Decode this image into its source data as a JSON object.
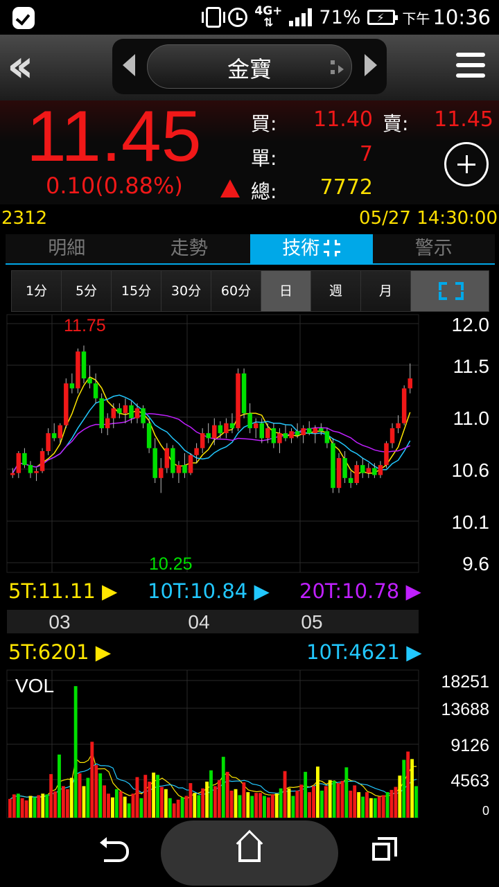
{
  "status_bar": {
    "network": "4G+",
    "battery": "71%",
    "time_prefix": "下午",
    "time": "10:36"
  },
  "header": {
    "stock_name": "金寶"
  },
  "quote": {
    "last_price": "11.45",
    "change": "0.10(0.88%)",
    "bid_label": "買:",
    "bid": "11.40",
    "ask_label": "賣:",
    "ask": "11.45",
    "lot_label": "單:",
    "lot": "7",
    "total_label": "總:",
    "total": "7772",
    "code": "2312",
    "datetime": "05/27 14:30:00",
    "up_color": "#f01818",
    "down_color": "#00e000"
  },
  "tabs": [
    {
      "label": "明細",
      "active": false
    },
    {
      "label": "走勢",
      "active": false
    },
    {
      "label": "技術",
      "active": true
    },
    {
      "label": "警示",
      "active": false
    }
  ],
  "periods": [
    {
      "label": "1分",
      "active": false
    },
    {
      "label": "5分",
      "active": false
    },
    {
      "label": "15分",
      "active": false
    },
    {
      "label": "30分",
      "active": false
    },
    {
      "label": "60分",
      "active": false
    },
    {
      "label": "日",
      "active": true
    },
    {
      "label": "週",
      "active": false
    },
    {
      "label": "月",
      "active": false
    }
  ],
  "ma_legend": {
    "ma5": "5T:11.11",
    "ma10": "10T:10.84",
    "ma20": "20T:10.78",
    "vol5": "5T:6201",
    "vol10": "10T:4621",
    "ma5_color": "#ffe600",
    "ma10_color": "#22c8ff",
    "ma20_color": "#c020ff"
  },
  "chart_data": [
    {
      "type": "candlestick",
      "y_ticks": [
        "12.0",
        "11.5",
        "11.0",
        "10.6",
        "10.1",
        "9.6"
      ],
      "x_ticks": [
        "03",
        "04",
        "05"
      ],
      "high_label": "11.75",
      "low_label": "10.25",
      "ylim": [
        9.6,
        12.0
      ],
      "candles": [
        [
          10.48,
          10.55,
          10.45,
          10.5
        ],
        [
          10.5,
          10.72,
          10.45,
          10.7
        ],
        [
          10.7,
          10.75,
          10.55,
          10.58
        ],
        [
          10.58,
          10.62,
          10.45,
          10.5
        ],
        [
          10.5,
          10.55,
          10.42,
          10.52
        ],
        [
          10.52,
          10.75,
          10.5,
          10.72
        ],
        [
          10.72,
          10.95,
          10.68,
          10.9
        ],
        [
          10.9,
          11.0,
          10.82,
          10.85
        ],
        [
          10.85,
          11.0,
          10.8,
          10.98
        ],
        [
          10.98,
          11.45,
          10.95,
          11.4
        ],
        [
          11.4,
          11.5,
          11.3,
          11.35
        ],
        [
          11.35,
          11.75,
          11.3,
          11.72
        ],
        [
          11.72,
          11.78,
          11.4,
          11.45
        ],
        [
          11.45,
          11.58,
          11.35,
          11.4
        ],
        [
          11.4,
          11.5,
          11.2,
          11.25
        ],
        [
          11.25,
          11.3,
          10.9,
          10.95
        ],
        [
          10.95,
          11.1,
          10.88,
          11.05
        ],
        [
          11.05,
          11.2,
          10.95,
          11.15
        ],
        [
          11.15,
          11.2,
          11.05,
          11.1
        ],
        [
          11.1,
          11.25,
          11.0,
          11.18
        ],
        [
          11.18,
          11.22,
          11.0,
          11.05
        ],
        [
          11.05,
          11.2,
          11.0,
          11.15
        ],
        [
          11.15,
          11.18,
          10.95,
          11.0
        ],
        [
          11.0,
          11.05,
          10.7,
          10.75
        ],
        [
          10.75,
          10.85,
          10.4,
          10.45
        ],
        [
          10.45,
          10.65,
          10.3,
          10.55
        ],
        [
          10.55,
          10.8,
          10.5,
          10.75
        ],
        [
          10.75,
          10.78,
          10.45,
          10.5
        ],
        [
          10.5,
          10.62,
          10.4,
          10.58
        ],
        [
          10.58,
          10.7,
          10.45,
          10.5
        ],
        [
          10.5,
          10.7,
          10.48,
          10.68
        ],
        [
          10.68,
          10.8,
          10.6,
          10.75
        ],
        [
          10.75,
          10.95,
          10.7,
          10.9
        ],
        [
          10.9,
          11.0,
          10.8,
          10.85
        ],
        [
          10.85,
          11.05,
          10.78,
          10.98
        ],
        [
          10.98,
          11.02,
          10.85,
          10.9
        ],
        [
          10.9,
          11.05,
          10.85,
          11.0
        ],
        [
          11.0,
          11.1,
          10.9,
          10.95
        ],
        [
          10.95,
          11.55,
          10.92,
          11.5
        ],
        [
          11.5,
          11.55,
          11.05,
          11.1
        ],
        [
          11.1,
          11.2,
          10.9,
          10.95
        ],
        [
          10.95,
          11.05,
          10.85,
          11.0
        ],
        [
          11.0,
          11.05,
          10.8,
          10.85
        ],
        [
          10.85,
          11.0,
          10.8,
          10.95
        ],
        [
          10.95,
          11.0,
          10.75,
          10.8
        ],
        [
          10.8,
          10.95,
          10.7,
          10.9
        ],
        [
          10.9,
          10.98,
          10.82,
          10.85
        ],
        [
          10.85,
          10.95,
          10.8,
          10.92
        ],
        [
          10.92,
          11.0,
          10.85,
          10.88
        ],
        [
          10.88,
          10.98,
          10.8,
          10.95
        ],
        [
          10.95,
          11.02,
          10.88,
          10.9
        ],
        [
          10.9,
          10.98,
          10.8,
          10.95
        ],
        [
          10.95,
          11.0,
          10.88,
          10.92
        ],
        [
          10.92,
          10.95,
          10.75,
          10.8
        ],
        [
          10.8,
          10.85,
          10.3,
          10.35
        ],
        [
          10.35,
          10.7,
          10.3,
          10.65
        ],
        [
          10.65,
          10.72,
          10.4,
          10.45
        ],
        [
          10.45,
          10.52,
          10.35,
          10.4
        ],
        [
          10.4,
          10.62,
          10.38,
          10.58
        ],
        [
          10.58,
          10.65,
          10.45,
          10.5
        ],
        [
          10.5,
          10.6,
          10.45,
          10.55
        ],
        [
          10.55,
          10.6,
          10.45,
          10.48
        ],
        [
          10.48,
          10.62,
          10.45,
          10.58
        ],
        [
          10.58,
          10.82,
          10.55,
          10.8
        ],
        [
          10.8,
          11.0,
          10.75,
          10.95
        ],
        [
          10.95,
          11.08,
          10.9,
          11.0
        ],
        [
          11.0,
          11.38,
          10.98,
          11.35
        ],
        [
          11.35,
          11.6,
          11.3,
          11.45
        ]
      ],
      "ma5_last": 11.11,
      "ma10_last": 10.84,
      "ma20_last": 10.78
    },
    {
      "type": "bar",
      "title": "VOL",
      "y_ticks": [
        "18251",
        "13688",
        "9126",
        "4563",
        "0"
      ],
      "ylim": [
        0,
        18251
      ],
      "volumes": [
        2500,
        3100,
        3200,
        2600,
        2300,
        2900,
        2700,
        3000,
        3200,
        3100,
        5800,
        3500,
        8400,
        4200,
        3800,
        5300,
        17500,
        5900,
        4200,
        5300,
        10100,
        7000,
        5900,
        4300,
        3200,
        2700,
        3800,
        3500,
        2800,
        1900,
        3200,
        5400,
        2600,
        5700,
        4800,
        6000,
        5700,
        4100,
        3800,
        2600,
        1900,
        2400,
        2700,
        2900,
        4600,
        3300,
        3000,
        3900,
        4800,
        6300,
        4200,
        5000,
        8100,
        6100,
        3600,
        3800,
        3000,
        4700,
        3400,
        2900,
        3300,
        3300,
        2900,
        2700,
        3100,
        3200,
        3900,
        6200,
        3900,
        2900,
        3600,
        4400,
        6100,
        3400,
        4200,
        6800,
        3600,
        4200,
        5000,
        4900,
        4600,
        4900,
        6700,
        3600,
        4300,
        3400,
        2800,
        3400,
        2600,
        2600,
        2800,
        3000,
        3400,
        3700,
        4100,
        5600,
        7700,
        8800,
        7800,
        4200
      ]
    }
  ]
}
